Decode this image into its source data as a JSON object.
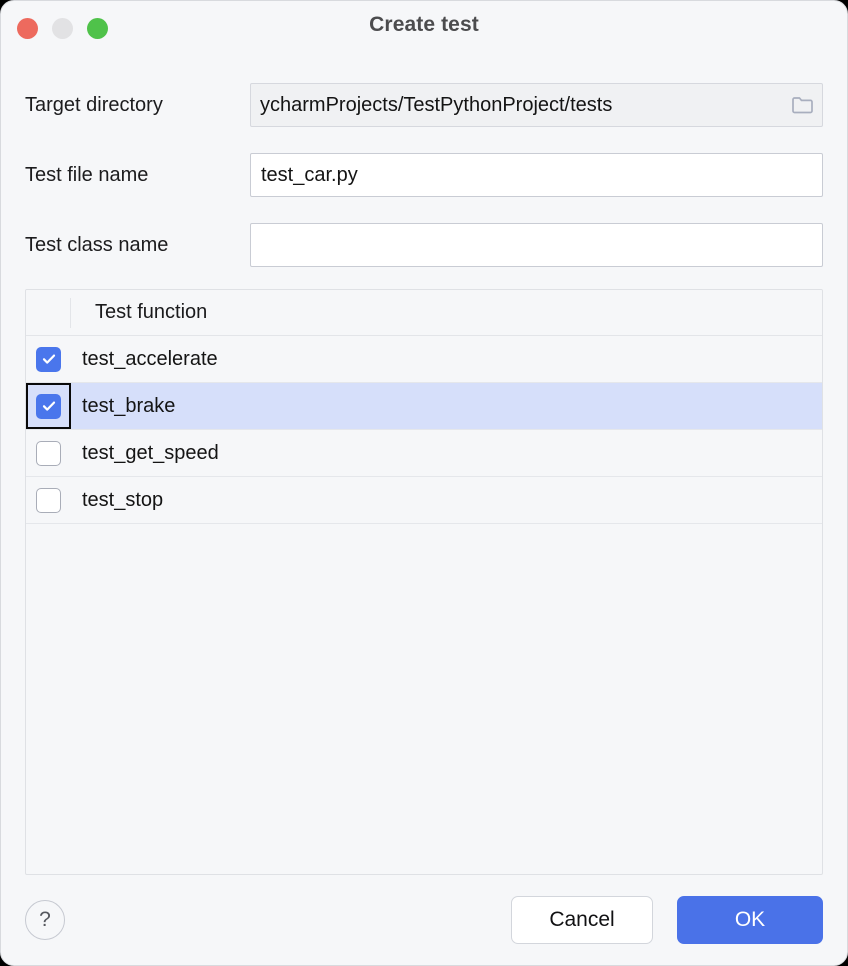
{
  "window": {
    "title": "Create test",
    "controls": [
      {
        "name": "close",
        "color": "#ED6A5E"
      },
      {
        "name": "minimize",
        "color": "#E2E2E4"
      },
      {
        "name": "maximize",
        "color": "#4FC24A"
      }
    ]
  },
  "form": {
    "target_directory": {
      "label": "Target directory",
      "value": "ycharmProjects/TestPythonProject/tests",
      "placeholder": "",
      "browse_icon": "folder-icon"
    },
    "test_file_name": {
      "label": "Test file name",
      "value": "test_car.py",
      "placeholder": ""
    },
    "test_class_name": {
      "label": "Test class name",
      "value": "",
      "placeholder": ""
    }
  },
  "table": {
    "columns": [
      "",
      "Test function"
    ],
    "rows": [
      {
        "name": "test_accelerate",
        "checked": true,
        "selected": false
      },
      {
        "name": "test_brake",
        "checked": true,
        "selected": true
      },
      {
        "name": "test_get_speed",
        "checked": false,
        "selected": false
      },
      {
        "name": "test_stop",
        "checked": false,
        "selected": false
      }
    ]
  },
  "footer": {
    "help_label": "?",
    "cancel_label": "Cancel",
    "ok_label": "OK"
  },
  "colors": {
    "accent": "#4A72E8",
    "selection": "#D6DFFA",
    "background": "#F6F7F9",
    "field_border": "#C9CCD4"
  }
}
